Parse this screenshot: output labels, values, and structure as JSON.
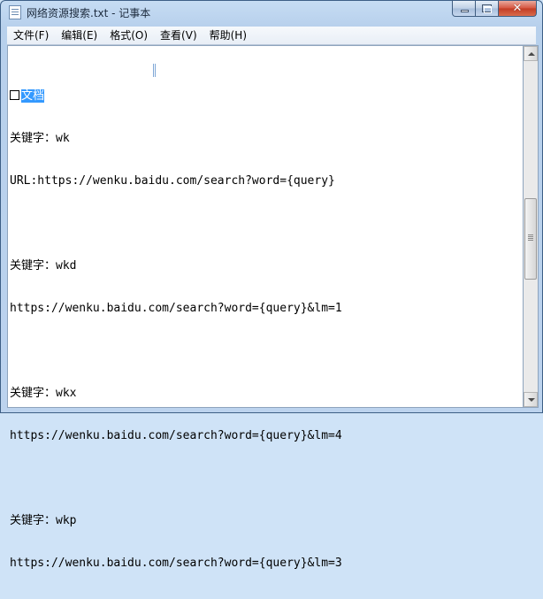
{
  "window": {
    "title": "网络资源搜索.txt - 记事本",
    "close_glyph": "✕"
  },
  "menu": [
    {
      "label": "文件(F)"
    },
    {
      "label": "编辑(E)"
    },
    {
      "label": "格式(O)"
    },
    {
      "label": "查看(V)"
    },
    {
      "label": "帮助(H)"
    }
  ],
  "document": {
    "selected_text": "文档",
    "lines": [
      "关键字：wk",
      "URL:https://wenku.baidu.com/search?word={query}",
      "",
      "关键字：wkd",
      "https://wenku.baidu.com/search?word={query}&lm=1",
      "",
      "关键字：wkx",
      "https://wenku.baidu.com/search?word={query}&lm=4",
      "",
      "关键字：wkp",
      "https://wenku.baidu.com/search?word={query}&lm=3"
    ]
  },
  "colors": {
    "selection": "#3399ff",
    "close_button": "#c23b24"
  }
}
